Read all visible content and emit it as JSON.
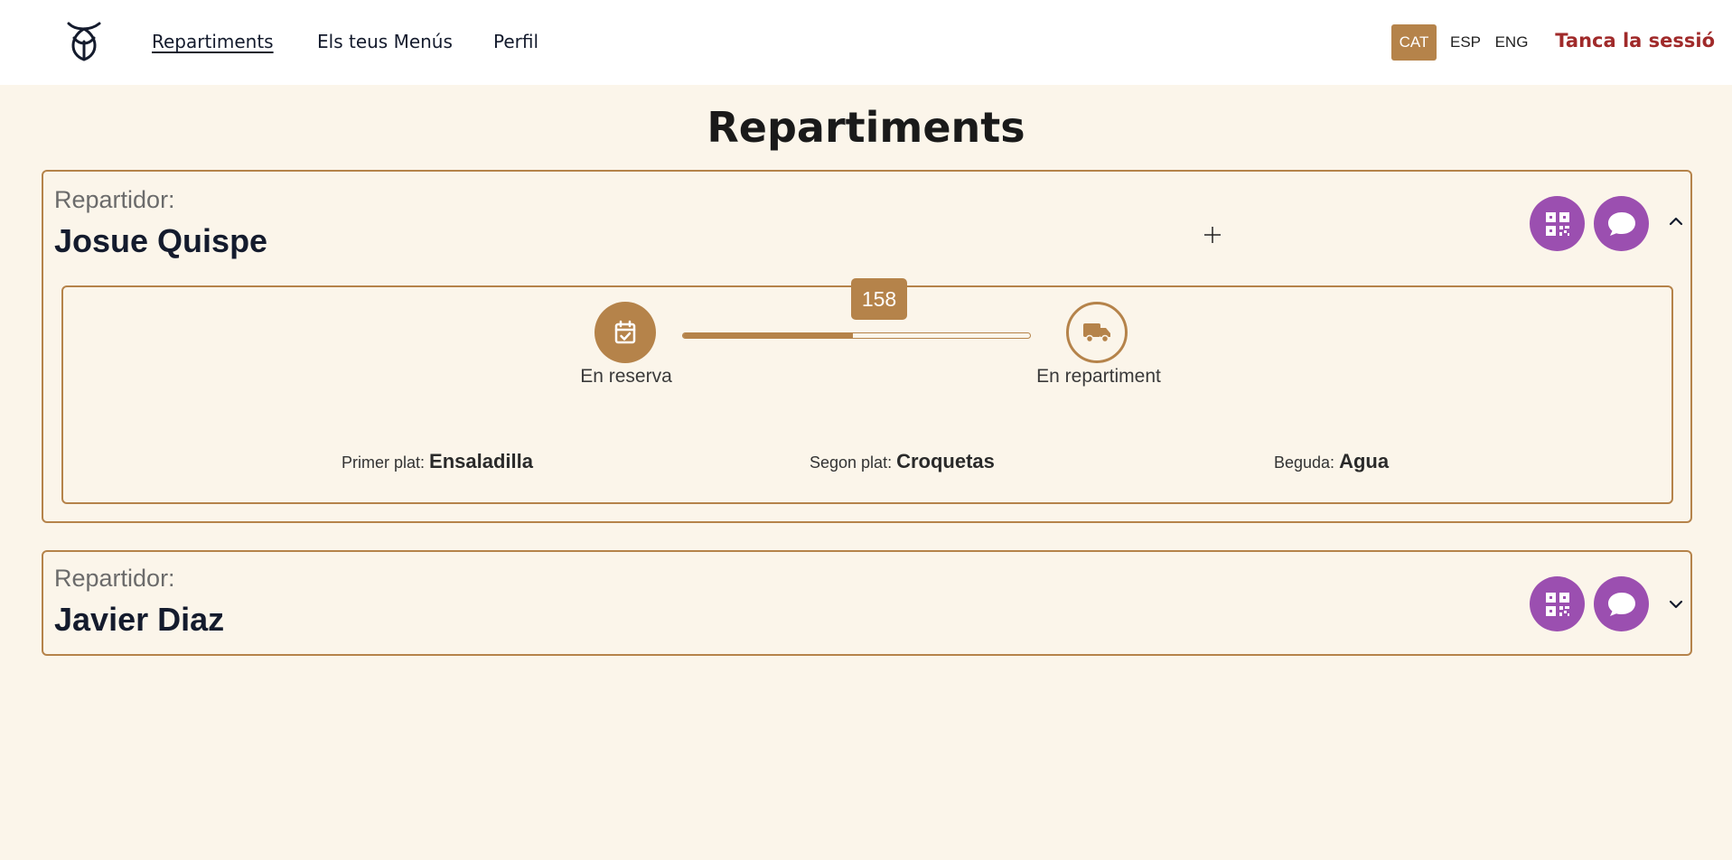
{
  "nav": {
    "links": [
      "Repartiments",
      "Els teus Menús",
      "Perfil"
    ],
    "languages": [
      "CAT",
      "ESP",
      "ENG"
    ],
    "active_language": "CAT",
    "logout": "Tanca la sessió"
  },
  "page": {
    "title": "Repartiments"
  },
  "deliveries": [
    {
      "label": "Repartidor:",
      "name": "Josue Quispe",
      "expanded": true,
      "progress": {
        "value": "158",
        "fraction": 0.49,
        "steps": [
          "En reserva",
          "En repartiment"
        ]
      },
      "meals": [
        {
          "label": "Primer plat:",
          "value": "Ensaladilla"
        },
        {
          "label": "Segon plat:",
          "value": "Croquetas"
        },
        {
          "label": "Beguda:",
          "value": "Agua"
        }
      ]
    },
    {
      "label": "Repartidor:",
      "name": "Javier Diaz",
      "expanded": false
    }
  ],
  "icons": {
    "logo": "brand-logo-icon",
    "qr": "qr-code-icon",
    "chat": "chat-bubble-icon",
    "calendar": "calendar-check-icon",
    "truck": "truck-icon",
    "chevron_up": "chevron-up-icon",
    "chevron_down": "chevron-down-icon"
  },
  "colors": {
    "accent": "#b5834a",
    "purple": "#9b4fb0",
    "logout": "#a02a2a",
    "background": "#fbf5ea"
  }
}
